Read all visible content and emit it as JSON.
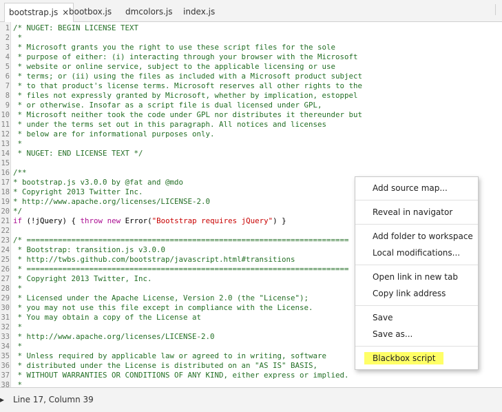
{
  "tabs": [
    {
      "label": "bootstrap.js",
      "active": true,
      "close": "×"
    },
    {
      "label": "bootbox.js",
      "active": false
    },
    {
      "label": "dmcolors.js",
      "active": false
    },
    {
      "label": "index.js",
      "active": false
    }
  ],
  "code_lines": [
    {
      "n": "1",
      "segs": [
        {
          "t": "/* NUGET: BEGIN LICENSE TEXT",
          "c": "c"
        }
      ]
    },
    {
      "n": "2",
      "segs": [
        {
          "t": " *",
          "c": "c"
        }
      ]
    },
    {
      "n": "3",
      "segs": [
        {
          "t": " * Microsoft grants you the right to use these script files for the sole",
          "c": "c"
        }
      ]
    },
    {
      "n": "4",
      "segs": [
        {
          "t": " * purpose of either: (i) interacting through your browser with the Microsoft",
          "c": "c"
        }
      ]
    },
    {
      "n": "5",
      "segs": [
        {
          "t": " * website or online service, subject to the applicable licensing or use",
          "c": "c"
        }
      ]
    },
    {
      "n": "6",
      "segs": [
        {
          "t": " * terms; or (ii) using the files as included with a Microsoft product subject",
          "c": "c"
        }
      ]
    },
    {
      "n": "7",
      "segs": [
        {
          "t": " * to that product's license terms. Microsoft reserves all other rights to the",
          "c": "c"
        }
      ]
    },
    {
      "n": "8",
      "segs": [
        {
          "t": " * files not expressly granted by Microsoft, whether by implication, estoppel",
          "c": "c"
        }
      ]
    },
    {
      "n": "9",
      "segs": [
        {
          "t": " * or otherwise. Insofar as a script file is dual licensed under GPL,",
          "c": "c"
        }
      ]
    },
    {
      "n": "10",
      "segs": [
        {
          "t": " * Microsoft neither took the code under GPL nor distributes it thereunder but",
          "c": "c"
        }
      ]
    },
    {
      "n": "11",
      "segs": [
        {
          "t": " * under the terms set out in this paragraph. All notices and licenses",
          "c": "c"
        }
      ]
    },
    {
      "n": "12",
      "segs": [
        {
          "t": " * below are for informational purposes only.",
          "c": "c"
        }
      ]
    },
    {
      "n": "13",
      "segs": [
        {
          "t": " *",
          "c": "c"
        }
      ]
    },
    {
      "n": "14",
      "segs": [
        {
          "t": " * NUGET: END LICENSE TEXT */",
          "c": "c"
        }
      ]
    },
    {
      "n": "15",
      "segs": [
        {
          "t": "",
          "c": ""
        }
      ]
    },
    {
      "n": "16",
      "segs": [
        {
          "t": "/**",
          "c": "c"
        }
      ]
    },
    {
      "n": "17",
      "segs": [
        {
          "t": "* bootstrap.js v3.0.0 by @fat and @mdo",
          "c": "c"
        }
      ]
    },
    {
      "n": "18",
      "segs": [
        {
          "t": "* Copyright 2013 Twitter Inc.",
          "c": "c"
        }
      ]
    },
    {
      "n": "19",
      "segs": [
        {
          "t": "* http://www.apache.org/licenses/LICENSE-2.0",
          "c": "c"
        }
      ]
    },
    {
      "n": "20",
      "segs": [
        {
          "t": "*/",
          "c": "c"
        }
      ]
    },
    {
      "n": "21",
      "segs": [
        {
          "t": "if",
          "c": "kw"
        },
        {
          "t": " (!jQuery) { ",
          "c": ""
        },
        {
          "t": "throw",
          "c": "kw"
        },
        {
          "t": " ",
          "c": ""
        },
        {
          "t": "new",
          "c": "kw"
        },
        {
          "t": " Error(",
          "c": ""
        },
        {
          "t": "\"Bootstrap requires jQuery\"",
          "c": "str"
        },
        {
          "t": ") }",
          "c": ""
        }
      ]
    },
    {
      "n": "22",
      "segs": [
        {
          "t": "",
          "c": ""
        }
      ]
    },
    {
      "n": "23",
      "segs": [
        {
          "t": "/* ========================================================================",
          "c": "c"
        }
      ]
    },
    {
      "n": "24",
      "segs": [
        {
          "t": " * Bootstrap: transition.js v3.0.0",
          "c": "c"
        }
      ]
    },
    {
      "n": "25",
      "segs": [
        {
          "t": " * http://twbs.github.com/bootstrap/javascript.html#transitions",
          "c": "c"
        }
      ]
    },
    {
      "n": "26",
      "segs": [
        {
          "t": " * ========================================================================",
          "c": "c"
        }
      ]
    },
    {
      "n": "27",
      "segs": [
        {
          "t": " * Copyright 2013 Twitter, Inc.",
          "c": "c"
        }
      ]
    },
    {
      "n": "28",
      "segs": [
        {
          "t": " *",
          "c": "c"
        }
      ]
    },
    {
      "n": "29",
      "segs": [
        {
          "t": " * Licensed under the Apache License, Version 2.0 (the \"License\");",
          "c": "c"
        }
      ]
    },
    {
      "n": "30",
      "segs": [
        {
          "t": " * you may not use this file except in compliance with the License.",
          "c": "c"
        }
      ]
    },
    {
      "n": "31",
      "segs": [
        {
          "t": " * You may obtain a copy of the License at",
          "c": "c"
        }
      ]
    },
    {
      "n": "32",
      "segs": [
        {
          "t": " *",
          "c": "c"
        }
      ]
    },
    {
      "n": "33",
      "segs": [
        {
          "t": " * http://www.apache.org/licenses/LICENSE-2.0",
          "c": "c"
        }
      ]
    },
    {
      "n": "34",
      "segs": [
        {
          "t": " *",
          "c": "c"
        }
      ]
    },
    {
      "n": "35",
      "segs": [
        {
          "t": " * Unless required by applicable law or agreed to in writing, software",
          "c": "c"
        }
      ]
    },
    {
      "n": "36",
      "segs": [
        {
          "t": " * distributed under the License is distributed on an \"AS IS\" BASIS,",
          "c": "c"
        }
      ]
    },
    {
      "n": "37",
      "segs": [
        {
          "t": " * WITHOUT WARRANTIES OR CONDITIONS OF ANY KIND, either express or implied.",
          "c": "c"
        }
      ]
    },
    {
      "n": "38",
      "segs": [
        {
          "t": " *",
          "c": "c"
        }
      ]
    }
  ],
  "context_menu": {
    "add_source_map": "Add source map...",
    "reveal_in_navigator": "Reveal in navigator",
    "add_folder_to_workspace": "Add folder to workspace",
    "local_modifications": "Local modifications...",
    "open_link_in_new_tab": "Open link in new tab",
    "copy_link_address": "Copy link address",
    "save": "Save",
    "save_as": "Save as...",
    "blackbox_script": "Blackbox script"
  },
  "status": {
    "cursor_position": "Line 17, Column 39"
  },
  "colors": {
    "comment": "#236e25",
    "keyword": "#aa0d91",
    "string": "#c80000",
    "highlight": "#ffff66"
  }
}
